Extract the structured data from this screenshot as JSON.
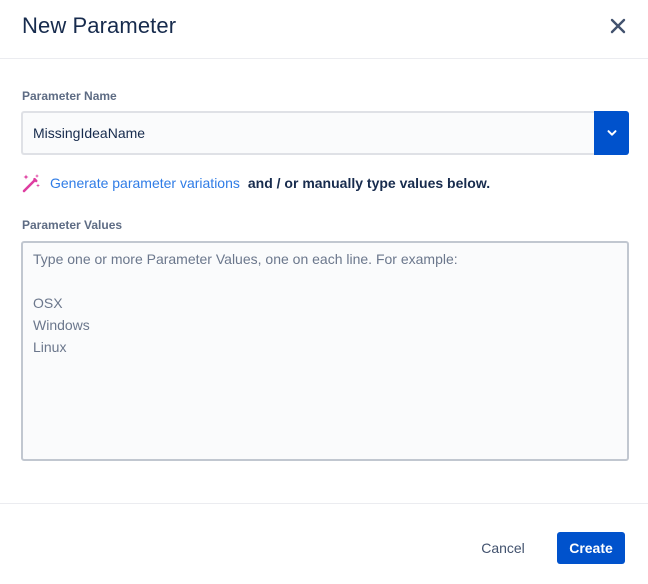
{
  "dialog": {
    "title": "New Parameter",
    "close_icon": "close-icon"
  },
  "parameter_name": {
    "label": "Parameter Name",
    "value": "MissingIdeaName",
    "dropdown_icon": "chevron-down-icon"
  },
  "generate": {
    "icon": "magic-wand-icon",
    "link_text": "Generate parameter variations",
    "rest_text": "and / or manually type values below."
  },
  "parameter_values": {
    "label": "Parameter Values",
    "placeholder": "Type one or more Parameter Values, one on each line. For example:\n\nOSX\nWindows\nLinux"
  },
  "footer": {
    "cancel_label": "Cancel",
    "create_label": "Create"
  },
  "colors": {
    "primary": "#0052CC",
    "link": "#2F7CE6",
    "wand": "#DE3DA0",
    "text": "#172B4D",
    "label": "#5E6C84"
  }
}
